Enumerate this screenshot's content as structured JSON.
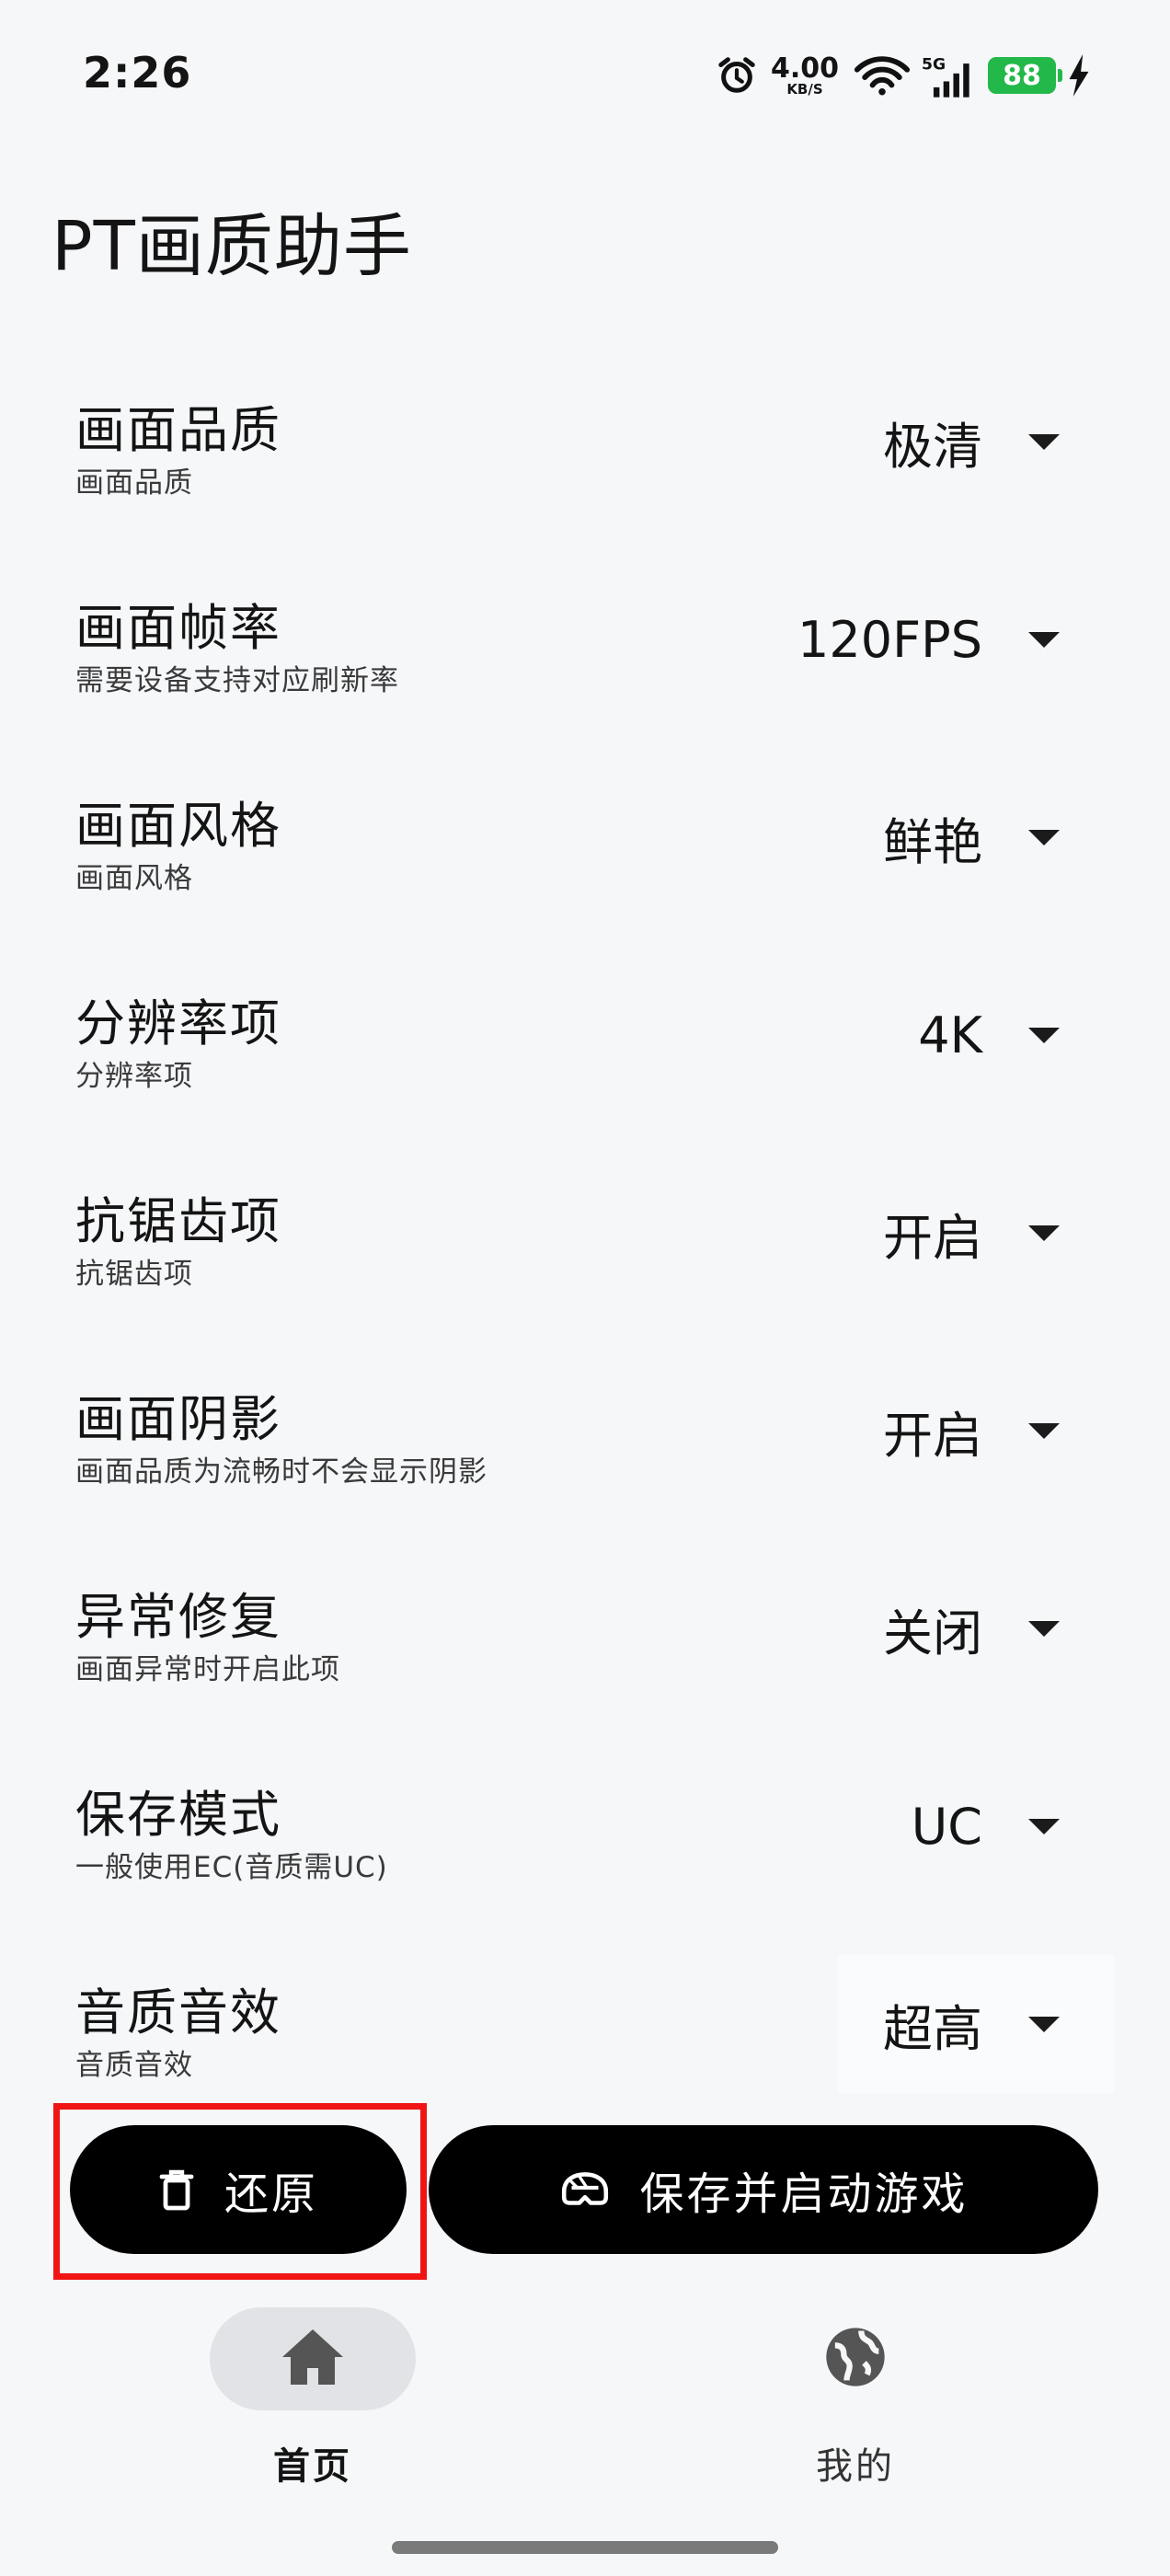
{
  "status_bar": {
    "time": "2:26",
    "net_speed_value": "4.00",
    "net_speed_unit": "KB/S",
    "battery": "88",
    "icons": [
      "alarm-icon",
      "wifi-icon",
      "signal-5g-icon",
      "battery-icon",
      "charging-icon"
    ]
  },
  "app": {
    "title": "PT画质助手"
  },
  "settings": [
    {
      "title": "画面品质",
      "subtitle": "画面品质",
      "value": "极清"
    },
    {
      "title": "画面帧率",
      "subtitle": "需要设备支持对应刷新率",
      "value": "120FPS"
    },
    {
      "title": "画面风格",
      "subtitle": "画面风格",
      "value": "鲜艳"
    },
    {
      "title": "分辨率项",
      "subtitle": "分辨率项",
      "value": "4K"
    },
    {
      "title": "抗锯齿项",
      "subtitle": "抗锯齿项",
      "value": "开启"
    },
    {
      "title": "画面阴影",
      "subtitle": "画面品质为流畅时不会显示阴影",
      "value": "开启"
    },
    {
      "title": "异常修复",
      "subtitle": "画面异常时开启此项",
      "value": "关闭"
    },
    {
      "title": "保存模式",
      "subtitle": "一般使用EC(音质需UC)",
      "value": "UC"
    },
    {
      "title": "音质音效",
      "subtitle": "音质音效",
      "value": "超高"
    }
  ],
  "actions": {
    "restore_label": "还原",
    "launch_label": "保存并启动游戏"
  },
  "nav": {
    "home_label": "首页",
    "mine_label": "我的"
  },
  "colors": {
    "background": "#f6f7f9",
    "button": "#000000",
    "highlight": "#f01414",
    "battery": "#23b84a"
  }
}
